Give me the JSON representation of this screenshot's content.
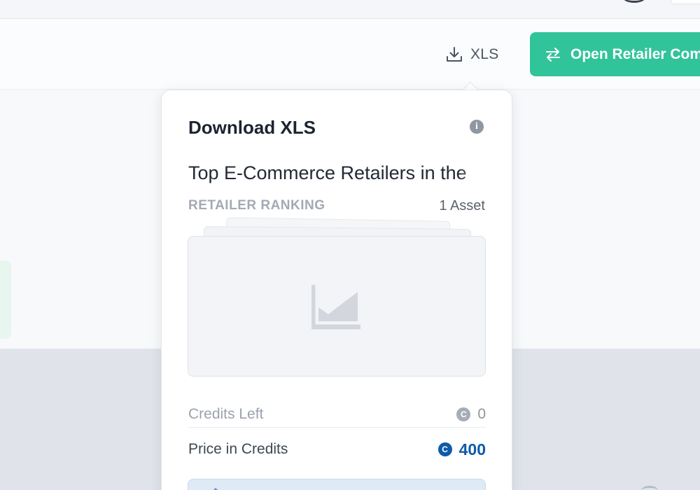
{
  "toolbar": {
    "xls_label": "XLS",
    "open_button_label": "Open Retailer Comparison",
    "accent_color": "#31c49a"
  },
  "popover": {
    "title": "Download XLS",
    "info_icon": "info-icon",
    "report_title": "Top E-Commerce Retailers in the",
    "category": "RETAILER RANKING",
    "asset_count": "1 Asset",
    "thumbnail_icon": "area-chart-icon",
    "credits_left_label": "Credits Left",
    "credits_left_value": "0",
    "price_label": "Price in Credits",
    "price_value": "400",
    "credit_icon_glyph": "C",
    "price_color": "#0e5ba8"
  }
}
